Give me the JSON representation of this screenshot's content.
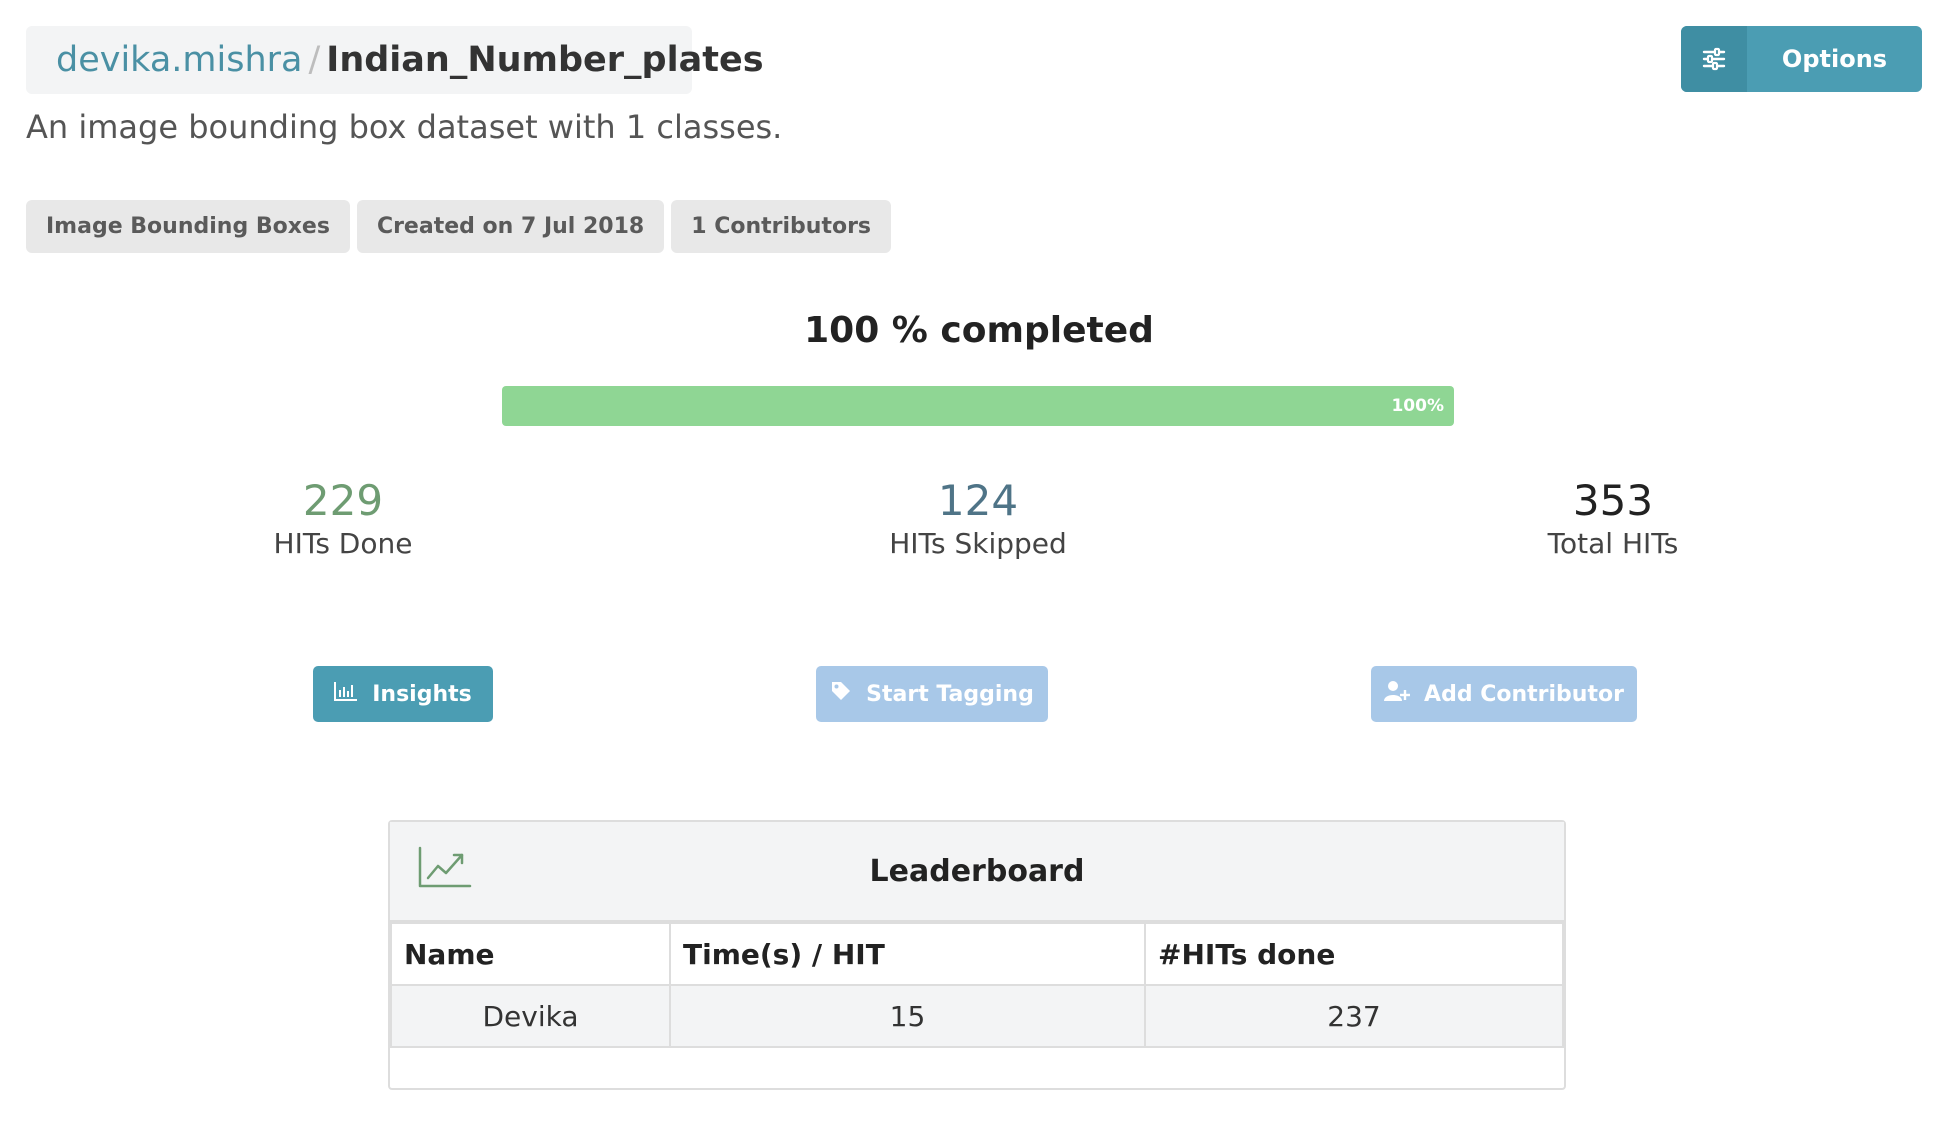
{
  "header": {
    "owner": "devika.mishra",
    "separator": "/",
    "dataset_name": "Indian_Number_plates",
    "description": "An image bounding box dataset with 1 classes.",
    "options_label": "Options",
    "options_icon": "sliders-icon"
  },
  "tags": [
    {
      "label": "Image Bounding Boxes"
    },
    {
      "label": "Created on 7 Jul 2018"
    },
    {
      "label": "1 Contributors"
    }
  ],
  "progress": {
    "title": "100 % completed",
    "percent": 100,
    "bar_label": "100%",
    "fill_color": "#8fd694"
  },
  "stats": {
    "done": {
      "value": "229",
      "label": "HITs Done"
    },
    "skipped": {
      "value": "124",
      "label": "HITs Skipped"
    },
    "total": {
      "value": "353",
      "label": "Total HITs"
    }
  },
  "actions": {
    "insights": {
      "label": "Insights",
      "icon": "bar-chart-icon"
    },
    "start_tagging": {
      "label": "Start Tagging",
      "icon": "tag-icon"
    },
    "add_contributor": {
      "label": "Add Contributor",
      "icon": "add-user-icon"
    }
  },
  "leaderboard": {
    "title": "Leaderboard",
    "icon": "trending-up-icon",
    "columns": [
      "Name",
      "Time(s) / HIT",
      "#HITs done"
    ],
    "rows": [
      {
        "name": "Devika",
        "time_per_hit": "15",
        "hits_done": "237"
      }
    ]
  },
  "colors": {
    "accent": "#4b9db3",
    "disabled_button": "#a8c8e8",
    "done_number": "#6e9c72",
    "skipped_number": "#4f7487"
  }
}
